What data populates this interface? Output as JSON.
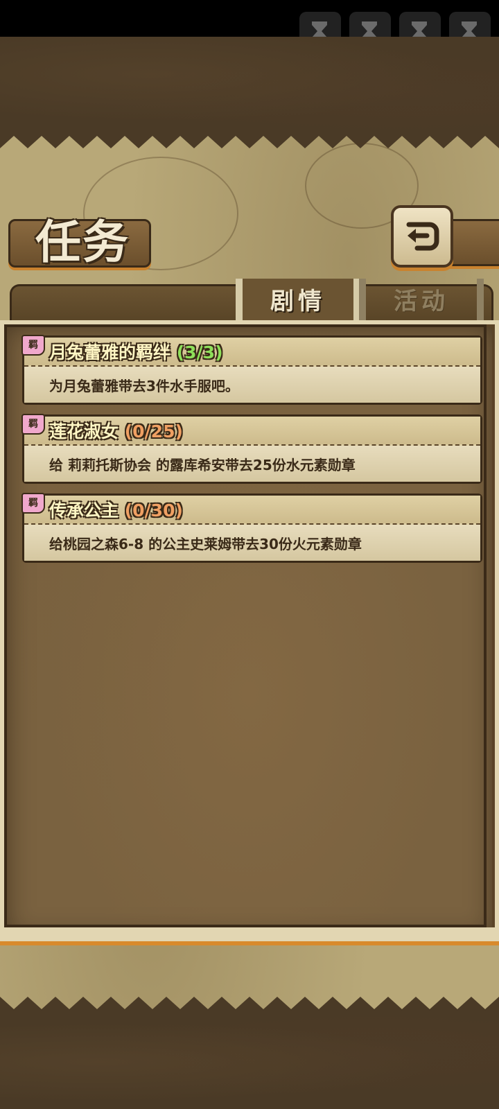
{
  "header": {
    "title": "任务",
    "back_icon": "return-arrow-icon"
  },
  "overlay_buttons": [
    {
      "icon": "hourglass-play-icon"
    },
    {
      "icon": "hourglass-play-icon"
    },
    {
      "icon": "hourglass-play-icon"
    },
    {
      "icon": "hourglass-play-icon"
    }
  ],
  "tabs": [
    {
      "label": "剧情",
      "active": true
    },
    {
      "label": "活动",
      "active": false
    }
  ],
  "quests": [
    {
      "tag": "羁",
      "name": "月兔蕾雅的羁绊",
      "progress": "(3/3)",
      "complete": true,
      "desc": "为月兔蕾雅带去3件水手服吧。"
    },
    {
      "tag": "羁",
      "name": "莲花淑女",
      "progress": "(0/25)",
      "complete": false,
      "desc": "给 莉莉托斯协会 的露库希安带去25份水元素勋章"
    },
    {
      "tag": "羁",
      "name": "传承公主",
      "progress": "(0/30)",
      "complete": false,
      "desc": "给桃园之森6-8 的公主史莱姆带去30份火元素勋章"
    }
  ],
  "colors": {
    "parchment": "#b8a878",
    "panel": "#7a6240",
    "accent_orange": "#d88a2c",
    "progress_done": "#8ee05a",
    "progress_pending": "#f0a063"
  }
}
